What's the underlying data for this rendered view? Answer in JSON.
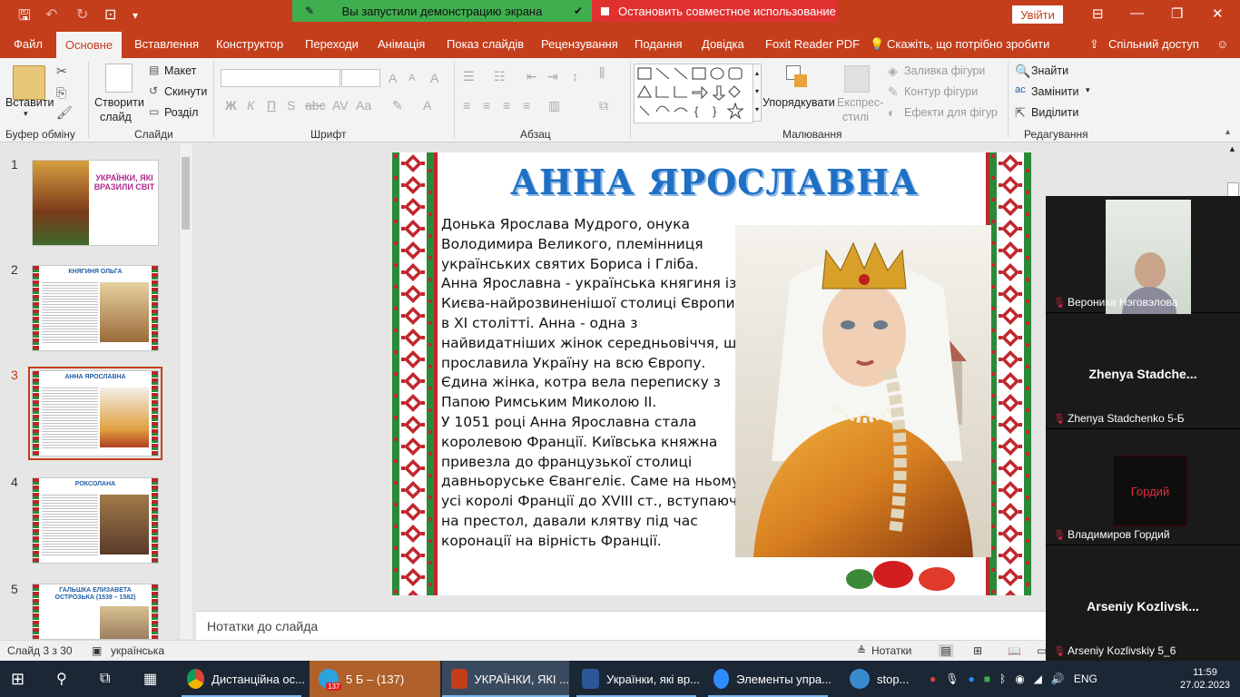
{
  "title_bar": {
    "share_status": "Вы запустили демонстрацию экрана",
    "stop_share": "Остановить совместное использование",
    "login": "Увійти"
  },
  "menu": {
    "file": "Файл",
    "home": "Основне",
    "insert": "Вставлення",
    "design": "Конструктор",
    "transitions": "Переходи",
    "animation": "Анімація",
    "slideshow": "Показ слайдів",
    "review": "Рецензування",
    "view": "Подання",
    "help": "Довідка",
    "foxit": "Foxit Reader PDF",
    "tellme": "Скажіть, що потрібно зробити",
    "share": "Спільний доступ"
  },
  "ribbon": {
    "paste": "Вставити",
    "clipboard": "Буфер обміну",
    "new_slide_1": "Створити",
    "new_slide_2": "слайд",
    "layout": "Макет",
    "reset": "Скинути",
    "section": "Розділ",
    "slides": "Слайди",
    "font": "Шрифт",
    "paragraph": "Абзац",
    "arrange": "Упорядкувати",
    "quick_styles_1": "Експрес-",
    "quick_styles_2": "стилі",
    "shape_fill": "Заливка фігури",
    "shape_outline": "Контур фігури",
    "shape_effects": "Ефекти для фігур",
    "drawing": "Малювання",
    "find": "Знайти",
    "replace": "Замінити",
    "select": "Виділити",
    "editing": "Редагування"
  },
  "thumbnails": [
    {
      "num": "1",
      "title": "УКРАЇНКИ, ЯКІ ВРАЗИЛИ СВІТ"
    },
    {
      "num": "2",
      "title": "КНЯГИНЯ ОЛЬГА"
    },
    {
      "num": "3",
      "title": "АННА ЯРОСЛАВНА"
    },
    {
      "num": "4",
      "title": "РОКСОЛАНА"
    },
    {
      "num": "5",
      "title": "ГАЛЬШКА ЕЛИЗАВЕТА ОСТРОЗЬКА (1539 – 1582)"
    }
  ],
  "slide": {
    "title": "АННА ЯРОСЛАВНА",
    "lines": [
      " Донька Ярослава Мудрого, онука",
      "Володимира Великого, племінниця",
      "українських святих Бориса і Гліба.",
      " Анна Ярославна - українська княгиня із",
      "Києва-найрозвиненішої столиці Європи",
      "в XI столітті. Анна - одна з",
      "найвидатніших жінок середньовіччя, що",
      "прославила Україну на всю Європу.",
      "Єдина жінка, котра вела переписку з",
      "Папою Римським Миколою II.",
      " У 1051 році Анна Ярославна стала",
      "королевою Франції. Київська княжна",
      "привезла до французької столиці",
      "давньоруське Євангеліє. Саме на ньому",
      "усі королі Франції до XVIII ст., вступаючи",
      "на престол, давали клятву під час",
      "коронації на вірність Франції."
    ]
  },
  "notes_placeholder": "Нотатки до слайда",
  "status": {
    "slide_info": "Слайд 3 з 30",
    "language": "українська",
    "notes": "Нотатки"
  },
  "zoom": {
    "participants": [
      {
        "label": "Вероника Нэговэлова",
        "center": ""
      },
      {
        "label": "Zhenya Stadchenko 5-Б",
        "center": "Zhenya  Stadche..."
      },
      {
        "label": "Владимиров Гордий",
        "center": "Гордий"
      },
      {
        "label": "Arseniy Kozlivskiy 5_6",
        "center": "Arseniy  Kozlivsk..."
      }
    ]
  },
  "taskbar": {
    "chrome": "Дистанційна ос...",
    "telegram": "5 Б – (137)",
    "telegram_badge": "137",
    "powerpoint": "УКРАЇНКИ, ЯКІ ...",
    "word": "Українки, які вр...",
    "zoom": "Элементы упра...",
    "stop": "stop...",
    "lang": "ENG",
    "time": "11:59",
    "date": "27.02.2023"
  },
  "colors": {
    "accent": "#c43e1c",
    "title_blue": "#1f6fc4",
    "taskbar": "#1b2735"
  }
}
